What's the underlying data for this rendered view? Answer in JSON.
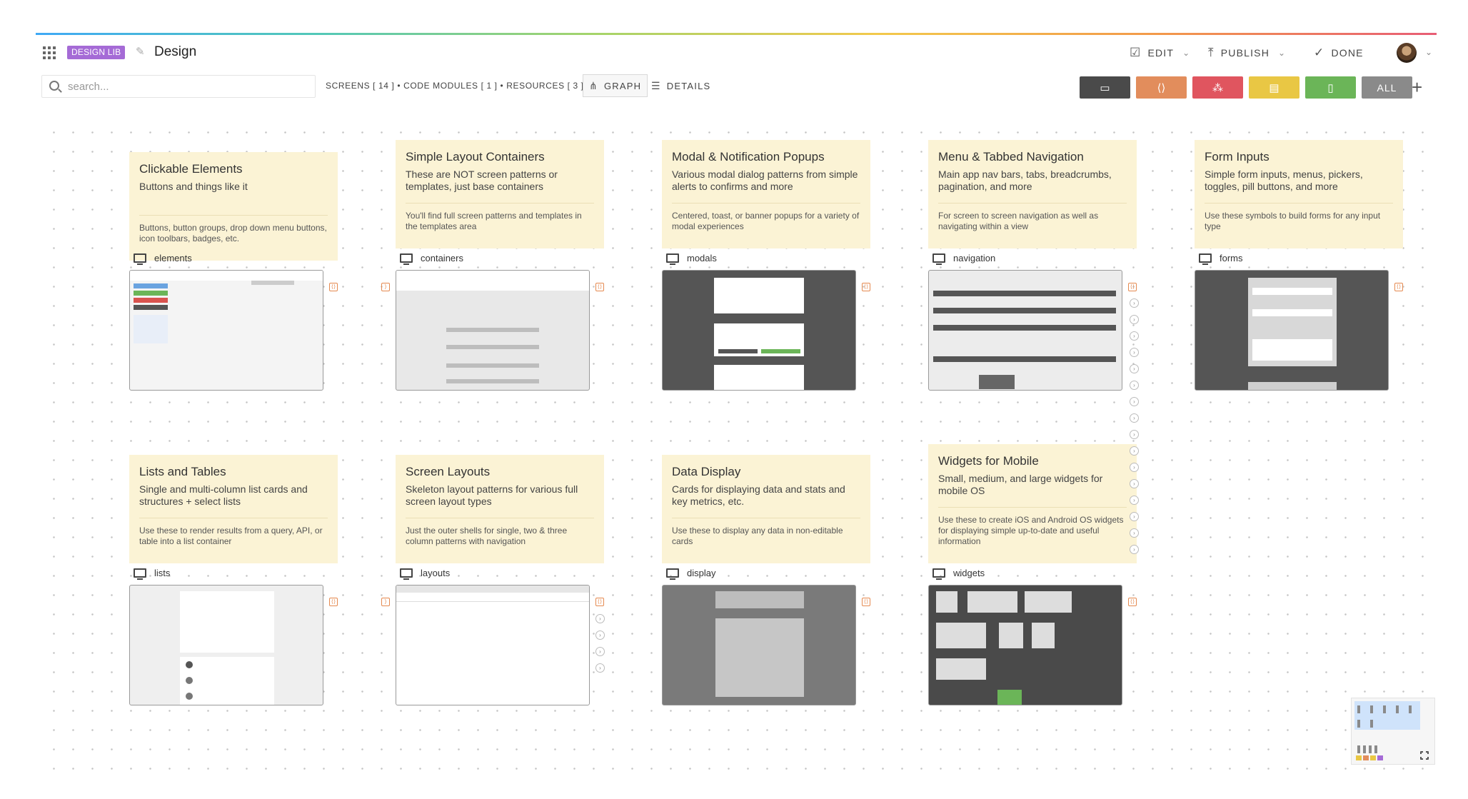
{
  "header": {
    "library_badge": "DESIGN LIB",
    "title": "Design",
    "edit_label": "EDIT",
    "publish_label": "PUBLISH",
    "done_label": "DONE"
  },
  "toolbar": {
    "search_placeholder": "search...",
    "summary": "SCREENS [ 14 ] • CODE MODULES [ 1 ] • RESOURCES [ 3 ]",
    "graph_label": "GRAPH",
    "details_label": "DETAILS",
    "all_label": "ALL"
  },
  "filters": [
    {
      "name": "screens",
      "icon": "monitor-icon",
      "color": "#4a4a4a"
    },
    {
      "name": "code",
      "icon": "code-icon",
      "color": "#e28d5c"
    },
    {
      "name": "resources",
      "icon": "flow-icon",
      "color": "#e0555f"
    },
    {
      "name": "notes",
      "icon": "comment-icon",
      "color": "#e9c744"
    },
    {
      "name": "mobile",
      "icon": "mobile-icon",
      "color": "#6bb558"
    },
    {
      "name": "all",
      "color": "#8a8a8a"
    }
  ],
  "groups": [
    {
      "title": "Clickable Elements",
      "subtitle": "Buttons and things like it",
      "description": "Buttons, button groups, drop down menu buttons, icon toolbars, badges, etc.",
      "screen": "elements"
    },
    {
      "title": "Simple Layout Containers",
      "subtitle": "These are NOT screen patterns or templates, just base containers",
      "description": "You'll find full screen patterns and templates in the templates area",
      "screen": "containers"
    },
    {
      "title": "Modal & Notification Popups",
      "subtitle": "Various modal dialog patterns from simple alerts to confirms and more",
      "description": "Centered, toast, or banner popups for a variety of modal experiences",
      "screen": "modals"
    },
    {
      "title": "Menu & Tabbed Navigation",
      "subtitle": "Main app nav bars, tabs, breadcrumbs, pagination, and more",
      "description": "For screen to screen navigation as well as navigating within a view",
      "screen": "navigation"
    },
    {
      "title": "Form Inputs",
      "subtitle": "Simple form inputs, menus, pickers, toggles, pill buttons, and more",
      "description": "Use these symbols to build forms for any input type",
      "screen": "forms"
    },
    {
      "title": "Lists and Tables",
      "subtitle": "Single and multi-column list cards and structures + select lists",
      "description": "Use these to render results from a query, API, or table into a list container",
      "screen": "lists"
    },
    {
      "title": "Screen Layouts",
      "subtitle": "Skeleton layout patterns for various full screen layout types",
      "description": "Just the outer shells for single, two & three column patterns with navigation",
      "screen": "layouts"
    },
    {
      "title": "Data Display",
      "subtitle": "Cards for displaying data and stats and key metrics, etc.",
      "description": "Use these to display any data in non-editable cards",
      "screen": "display"
    },
    {
      "title": "Widgets for Mobile",
      "subtitle": "Small, medium, and large widgets for mobile OS",
      "description": "Use these to create iOS and Android OS widgets for displaying simple up-to-date and useful information",
      "screen": "widgets"
    }
  ]
}
